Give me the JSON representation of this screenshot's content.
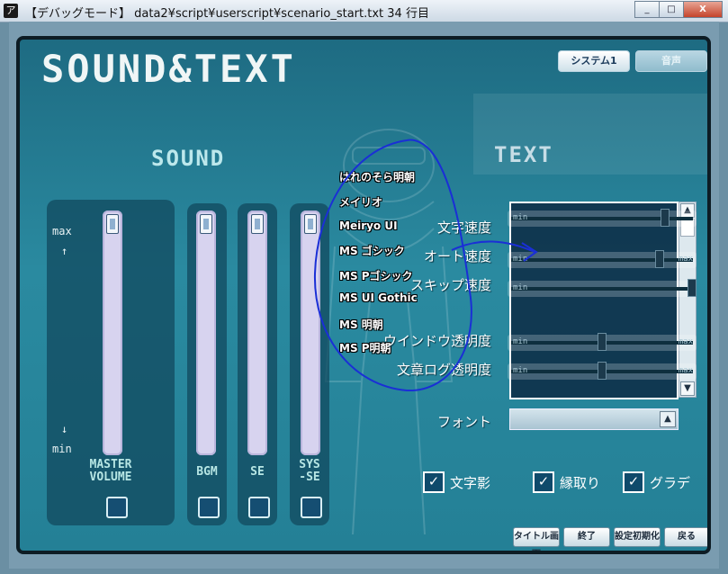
{
  "window": {
    "title": "【デバッグモード】 data2¥script¥userscript¥scenario_start.txt  34 行目",
    "app_icon": "ア",
    "minimize_glyph": "_",
    "maximize_glyph": "□",
    "close_glyph": "X"
  },
  "header": {
    "title": "SOUND&TEXT",
    "tabs": [
      {
        "label": "システム1"
      },
      {
        "label": "音声"
      }
    ]
  },
  "sound": {
    "heading": "SOUND",
    "axis_max": "max",
    "axis_min": "min",
    "arrow_up": "↑",
    "arrow_down": "↓",
    "sliders": [
      {
        "label_line1": "MASTER",
        "label_line2": "VOLUME",
        "level": 1.0
      },
      {
        "label_line1": "BGM",
        "label_line2": "",
        "level": 1.0
      },
      {
        "label_line1": "SE",
        "label_line2": "",
        "level": 1.0
      },
      {
        "label_line1": "SYS",
        "label_line2": "-SE",
        "level": 1.0
      }
    ]
  },
  "fonts": [
    "はれのそら明朝",
    "メイリオ",
    "Meiryo UI",
    "MS ゴシック",
    "MS Pゴシック",
    "MS UI Gothic",
    "MS 明朝",
    "MS P明朝"
  ],
  "text": {
    "heading": "TEXT",
    "min_label": "min",
    "max_label": "max",
    "settings": [
      {
        "label": "文字速度",
        "value": 0.85
      },
      {
        "label": "オート速度",
        "value": 0.82
      },
      {
        "label": "スキップ速度",
        "value": 1.0
      },
      {
        "label": "ウインドウ透明度",
        "value": 0.5
      },
      {
        "label": "文章ログ透明度",
        "value": 0.5
      }
    ],
    "font_label": "フォント",
    "options": [
      {
        "label": "文字影",
        "checked": true
      },
      {
        "label": "縁取り",
        "checked": true
      },
      {
        "label": "グラデ",
        "checked": true
      }
    ]
  },
  "footer": {
    "buttons": [
      "タイトル画面",
      "終了",
      "設定初期化",
      "戻る"
    ]
  },
  "colors": {
    "accent": "#1e6b82",
    "annotation": "#1a2fd6"
  }
}
